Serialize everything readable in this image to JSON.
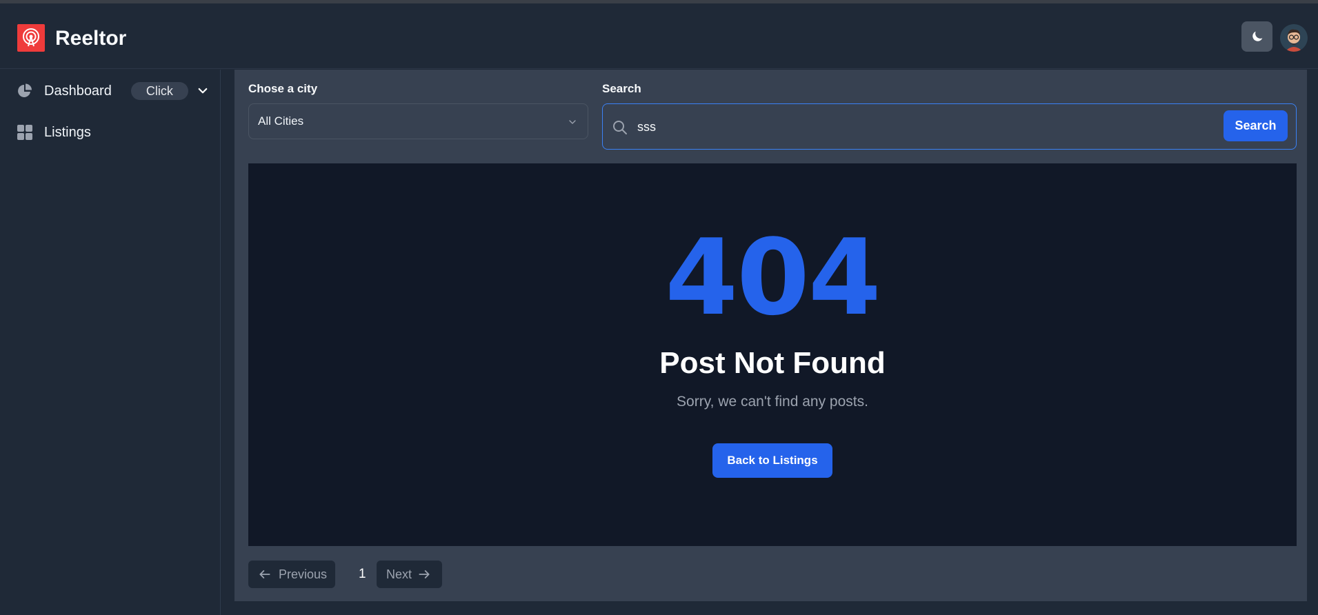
{
  "app": {
    "brand": "Reeltor",
    "colors": {
      "accent": "#2563eb",
      "logo": "#ef3b3b",
      "background": "#1f2937",
      "panel": "#111827"
    }
  },
  "header": {
    "theme_toggle_icon": "moon-icon",
    "avatar_icon": "user-avatar"
  },
  "sidebar": {
    "items": [
      {
        "label": "Dashboard",
        "icon": "pie-chart-icon",
        "badge": "Click",
        "expand_icon": "chevron-down-icon"
      },
      {
        "label": "Listings",
        "icon": "grid-icon"
      }
    ]
  },
  "filters": {
    "city_label": "Chose a city",
    "city_value": "All Cities",
    "search_label": "Search",
    "search_value": "sss",
    "search_button": "Search"
  },
  "error": {
    "code": "404",
    "title": "Post Not Found",
    "message": "Sorry, we can't find any posts.",
    "button": "Back to Listings"
  },
  "pagination": {
    "previous": "Previous",
    "current": "1",
    "next": "Next"
  }
}
